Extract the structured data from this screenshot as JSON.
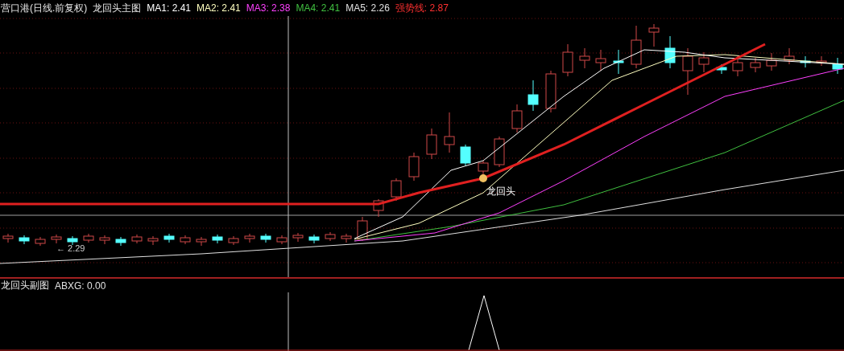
{
  "main_panel": {
    "title": "营口港(日线.前复权)",
    "indicator": "龙回头主图",
    "values": [
      {
        "label": "MA1:",
        "value": "2.41",
        "color": "#ffffff"
      },
      {
        "label": "MA2:",
        "value": "2.41",
        "color": "#ffffc0"
      },
      {
        "label": "MA3:",
        "value": "2.38",
        "color": "#ff40ff"
      },
      {
        "label": "MA4:",
        "value": "2.41",
        "color": "#40c040"
      },
      {
        "label": "MA5:",
        "value": "2.26",
        "color": "#e0e0e0"
      },
      {
        "label": "强势线:",
        "value": "2.87",
        "color": "#ff3030"
      }
    ],
    "low_label": "← 2.29",
    "signal_label": "龙回头"
  },
  "sub_panel": {
    "title": "龙回头副图",
    "values": [
      {
        "label": "ABXG:",
        "value": "0.00",
        "color": "#e0e0e0"
      }
    ]
  }
}
